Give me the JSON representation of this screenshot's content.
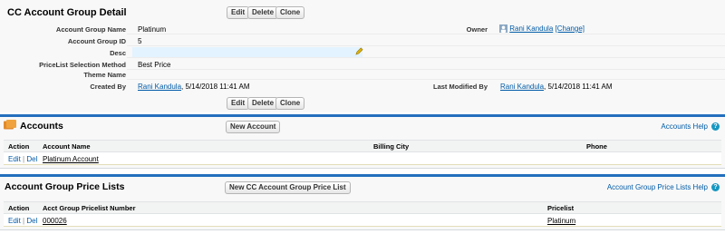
{
  "detail": {
    "title": "CC Account Group Detail",
    "buttons": {
      "edit": "Edit",
      "delete": "Delete",
      "clone": "Clone"
    },
    "fields": {
      "name_label": "Account Group Name",
      "name_value": "Platinum",
      "id_label": "Account Group ID",
      "id_value": "5",
      "desc_label": "Desc",
      "desc_value": "",
      "method_label": "PriceList Selection Method",
      "method_value": "Best Price",
      "theme_label": "Theme Name",
      "theme_value": "",
      "created_label": "Created By",
      "created_user": "Rani Kandula",
      "created_date": ", 5/14/2018 11:41 AM",
      "owner_label": "Owner",
      "owner_user": "Rani Kandula",
      "owner_change": "[Change]",
      "modified_label": "Last Modified By",
      "modified_user": "Rani Kandula",
      "modified_date": ", 5/14/2018 11:41 AM"
    }
  },
  "accounts": {
    "title": "Accounts",
    "new_button": "New Account",
    "help": "Accounts Help",
    "help_icon": "?",
    "columns": {
      "action": "Action",
      "name": "Account Name",
      "city": "Billing City",
      "phone": "Phone"
    },
    "row": {
      "edit": "Edit",
      "sep": "|",
      "del": "Del",
      "name": "Platinum Account",
      "city": "",
      "phone": ""
    }
  },
  "price_lists": {
    "title": "Account Group Price Lists",
    "new_button": "New CC Account Group Price List",
    "help": "Account Group Price Lists Help",
    "help_icon": "?",
    "columns": {
      "action": "Action",
      "number": "Acct Group Pricelist Number",
      "pricelist": "Pricelist"
    },
    "row": {
      "edit": "Edit",
      "sep": "|",
      "del": "Del",
      "number": "000026",
      "pricelist": "Platinum"
    }
  },
  "colors": {
    "accent": "#236fbd",
    "link": "#015ba7"
  }
}
